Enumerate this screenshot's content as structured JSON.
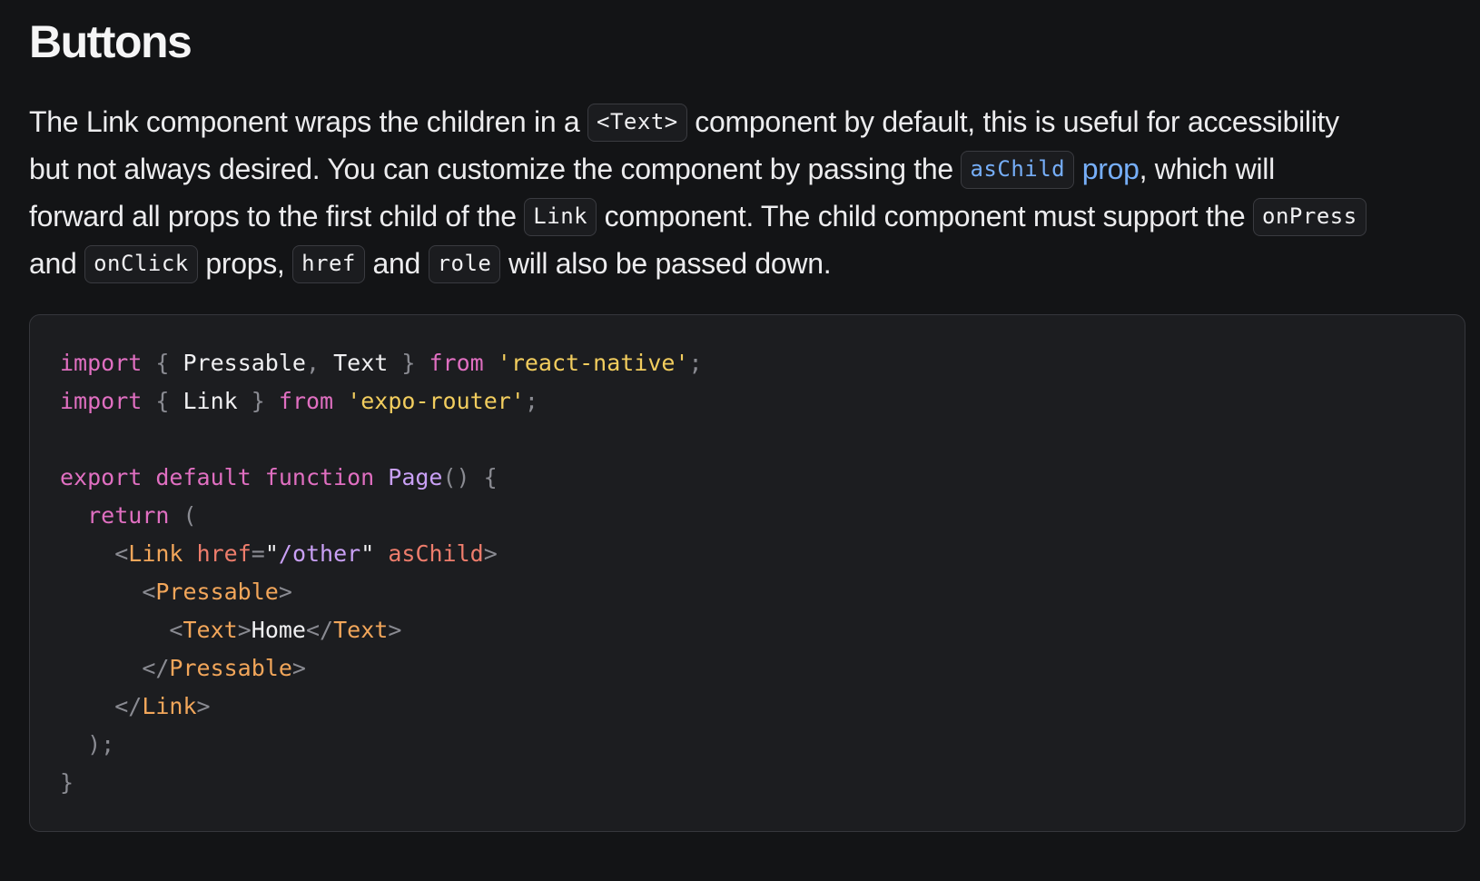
{
  "heading": "Buttons",
  "paragraph": {
    "l1_a": "The Link component wraps the children in a ",
    "l1_code": "<Text>",
    "l1_b": " component by default, this is useful for accessibility",
    "l2_a": "but not always desired. You can customize the component by passing the ",
    "l2_code": "asChild",
    "l2_link": "prop",
    "l2_b": ", which will",
    "l3_a": "forward all props to the first child of the ",
    "l3_code": "Link",
    "l3_b": " component. The child component must support the ",
    "l3_code2": "onPress",
    "l4_a": "and ",
    "l4_code": "onClick",
    "l4_b": " props, ",
    "l4_code2": "href",
    "l4_c": " and ",
    "l4_code3": "role",
    "l4_d": " will also be passed down."
  },
  "code": {
    "import": "import",
    "from": "from",
    "lbrace": "{",
    "rbrace": "}",
    "comma": ",",
    "semi": ";",
    "pressable": "Pressable",
    "text": "Text",
    "link": "Link",
    "rn": "'react-native'",
    "er": "'expo-router'",
    "export": "export",
    "default": "default",
    "function": "function",
    "page": "Page",
    "parens": "()",
    "return": "return",
    "lparen": "(",
    "lt": "<",
    "ltslash": "</",
    "gt": ">",
    "href": "href",
    "eq": "=",
    "quote": "\"",
    "other": "/other",
    "aschild": "asChild",
    "home": "Home",
    "closeparen": ");"
  }
}
